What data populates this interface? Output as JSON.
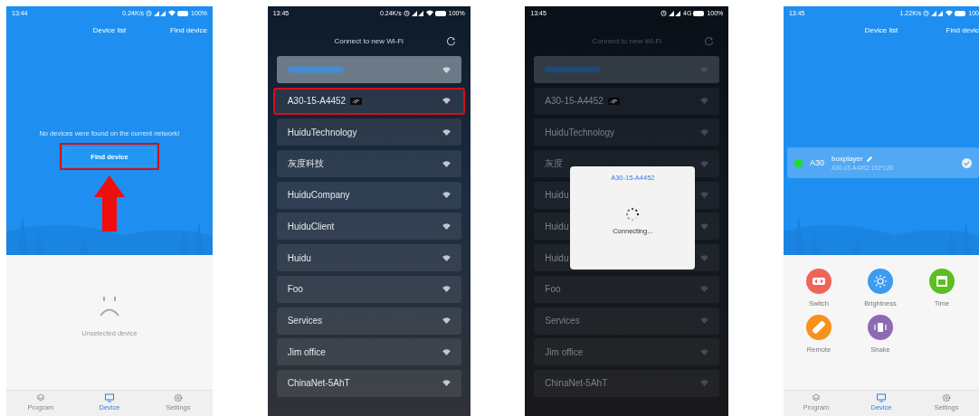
{
  "phones": [
    {
      "kind": "device_list",
      "status": {
        "time": "13:44",
        "speed": "0.24K/s",
        "wifi": true,
        "battery": "100%"
      },
      "header": {
        "title": "Device list",
        "action": "Find device"
      },
      "message": "No devices were found on the current network!",
      "find_button": {
        "label": "Find device",
        "highlighted": true
      },
      "empty_label": "Unselected device",
      "tabs": [
        {
          "label": "Program",
          "selected": false
        },
        {
          "label": "Device",
          "selected": true
        },
        {
          "label": "Settings",
          "selected": false
        }
      ]
    },
    {
      "kind": "wifi_list",
      "dimmed": false,
      "status": {
        "time": "13:45",
        "speed": "0.24K/s",
        "wifi": true,
        "battery": "100%"
      },
      "title": "Connect to new Wi-Fi",
      "networks": [
        {
          "kind": "hidden",
          "selected": true,
          "highlighted": false
        },
        {
          "kind": "named",
          "name": "A30-15-A4452",
          "badge": true,
          "selected": false,
          "highlighted": true
        },
        {
          "kind": "named",
          "name": "HuiduTechnology",
          "selected": false,
          "highlighted": false
        },
        {
          "kind": "named",
          "name": "灰度科技",
          "selected": false,
          "highlighted": false
        },
        {
          "kind": "named",
          "name": "HuiduCompany",
          "selected": false,
          "highlighted": false
        },
        {
          "kind": "named",
          "name": "HuiduClient",
          "selected": false,
          "highlighted": false
        },
        {
          "kind": "named",
          "name": "Huidu",
          "selected": false,
          "highlighted": false
        },
        {
          "kind": "named",
          "name": "Foo",
          "selected": false,
          "highlighted": false
        },
        {
          "kind": "named",
          "name": "Services",
          "selected": false,
          "highlighted": false
        },
        {
          "kind": "named",
          "name": "Jim office",
          "selected": false,
          "highlighted": false
        },
        {
          "kind": "named",
          "name": "ChinaNet-5AhT",
          "selected": false,
          "highlighted": false
        }
      ]
    },
    {
      "kind": "wifi_list",
      "dimmed": true,
      "status": {
        "time": "13:45",
        "network": "4G",
        "battery": "100%"
      },
      "title": "Connect to new Wi-Fi",
      "networks": [
        {
          "kind": "hidden",
          "selected": true,
          "highlighted": false
        },
        {
          "kind": "named",
          "name": "A30-15-A4452",
          "badge": true,
          "selected": false,
          "highlighted": false
        },
        {
          "kind": "named",
          "name": "HuiduTechnology",
          "selected": false,
          "highlighted": false
        },
        {
          "kind": "named",
          "name": "灰度",
          "selected": false,
          "highlighted": false
        },
        {
          "kind": "named",
          "name": "Huidu",
          "selected": false,
          "highlighted": false
        },
        {
          "kind": "named",
          "name": "Huidu",
          "selected": false,
          "highlighted": false
        },
        {
          "kind": "named",
          "name": "Huidu",
          "selected": false,
          "highlighted": false
        },
        {
          "kind": "named",
          "name": "Foo",
          "selected": false,
          "highlighted": false
        },
        {
          "kind": "named",
          "name": "Services",
          "selected": false,
          "highlighted": false
        },
        {
          "kind": "named",
          "name": "Jim office",
          "selected": false,
          "highlighted": false
        },
        {
          "kind": "named",
          "name": "ChinaNet-5AhT",
          "selected": false,
          "highlighted": false
        }
      ],
      "dialog": {
        "title": "A30-15-A4452",
        "message": "Connecting..."
      }
    },
    {
      "kind": "device_list",
      "status": {
        "time": "13:45",
        "speed": "1.22K/s",
        "wifi": true,
        "battery": "100"
      },
      "header": {
        "title": "Device list",
        "action": "Find devic"
      },
      "device": {
        "online": true,
        "color": "#22dd22",
        "model": "A30",
        "name": "boxplayer",
        "detail": "A30-15-A4452  192*128",
        "checked": true
      },
      "functions": [
        {
          "kind": "switch",
          "label": "Switch",
          "color": "#ef6459"
        },
        {
          "kind": "brightness",
          "label": "Brightness",
          "color": "#3d9bf0"
        },
        {
          "kind": "time",
          "label": "Time",
          "color": "#5bbf1f"
        },
        {
          "kind": "remote",
          "label": "Remote",
          "color": "#f7921d"
        },
        {
          "kind": "shake",
          "label": "Shake",
          "color": "#8c6bb4"
        }
      ],
      "tabs": [
        {
          "label": "Program",
          "selected": false
        },
        {
          "label": "Device",
          "selected": true
        },
        {
          "label": "Settings",
          "selected": false
        }
      ]
    }
  ]
}
